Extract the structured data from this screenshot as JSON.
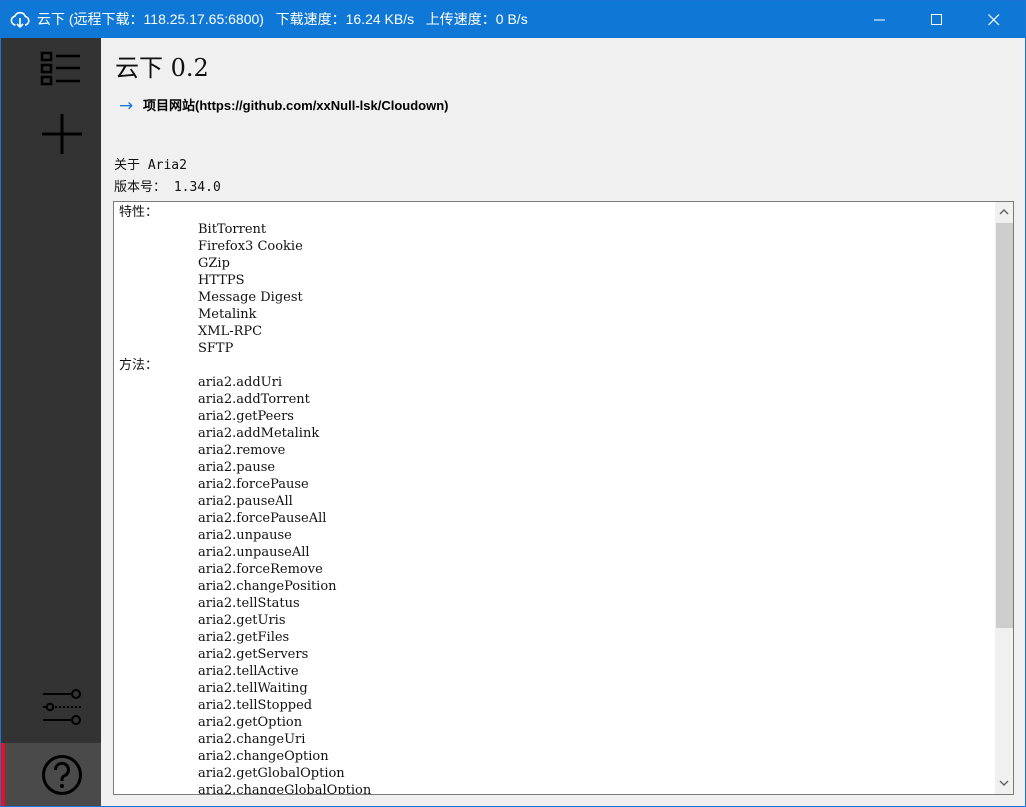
{
  "window": {
    "title": "云下 (远程下载：118.25.17.65:6800)",
    "download_speed": "下载速度：16.24 KB/s",
    "upload_speed": "上传速度：0 B/s",
    "title_color": "#0f78d7"
  },
  "sidebar": {
    "background": "#333333",
    "active_indicator_color": "#e81123",
    "items": [
      {
        "icon": "task-list-icon"
      },
      {
        "icon": "add-icon"
      },
      {
        "icon": "settings-sliders-icon"
      },
      {
        "icon": "help-icon",
        "active": true
      }
    ]
  },
  "main": {
    "app_title": "云下 0.2",
    "project_link": "项目网站(https://github.com/xxNull-lsk/Cloudown)",
    "link_arrow": "→",
    "about_title": "关于 Aria2",
    "version": "版本号： 1.34.0",
    "features_label": "特性：",
    "features": [
      "BitTorrent",
      "Firefox3 Cookie",
      "GZip",
      "HTTPS",
      "Message Digest",
      "Metalink",
      "XML-RPC",
      "SFTP"
    ],
    "methods_label": "方法：",
    "methods": [
      "aria2.addUri",
      "aria2.addTorrent",
      "aria2.getPeers",
      "aria2.addMetalink",
      "aria2.remove",
      "aria2.pause",
      "aria2.forcePause",
      "aria2.pauseAll",
      "aria2.forcePauseAll",
      "aria2.unpause",
      "aria2.unpauseAll",
      "aria2.forceRemove",
      "aria2.changePosition",
      "aria2.tellStatus",
      "aria2.getUris",
      "aria2.getFiles",
      "aria2.getServers",
      "aria2.tellActive",
      "aria2.tellWaiting",
      "aria2.tellStopped",
      "aria2.getOption",
      "aria2.changeUri",
      "aria2.changeOption",
      "aria2.getGlobalOption",
      "aria2.changeGlobalOption"
    ]
  }
}
